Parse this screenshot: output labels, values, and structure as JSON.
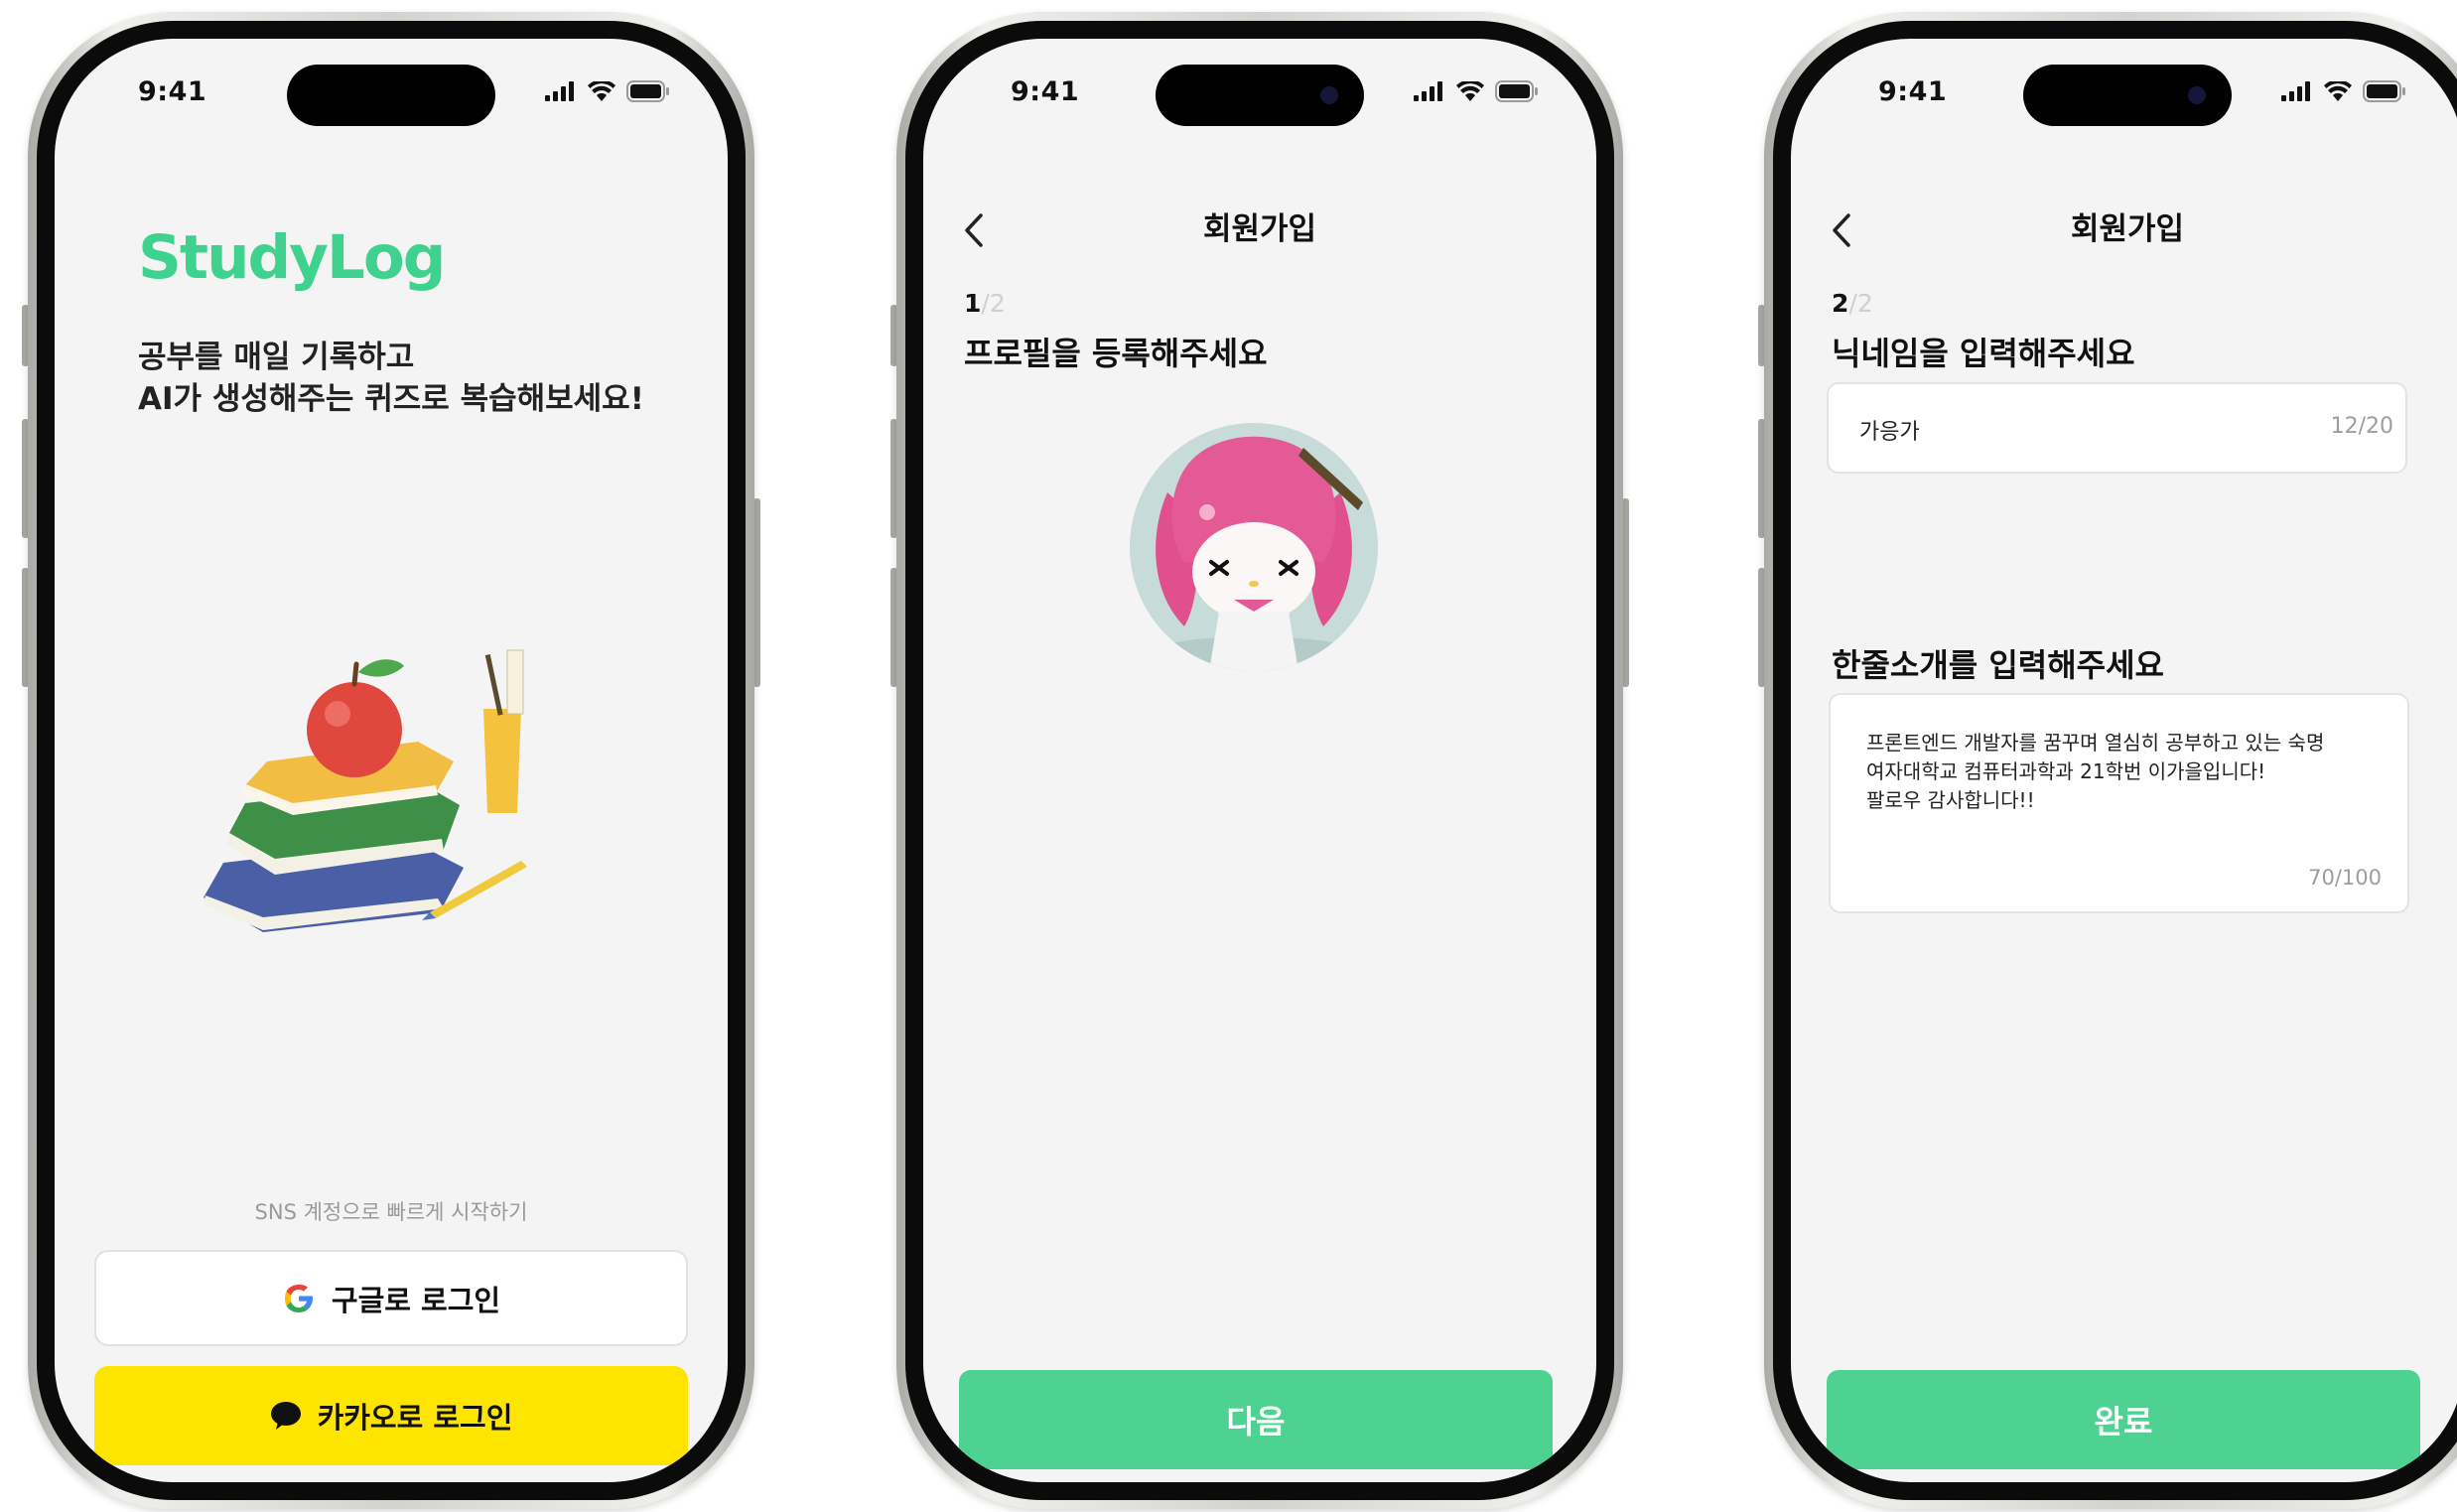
{
  "status_bar": {
    "time": "9:41"
  },
  "login": {
    "brand": "StudyLog",
    "tagline_line1": "공부를 매일 기록하고",
    "tagline_line2": "AI가 생성해주는 퀴즈로 복습해보세요!",
    "sns_hint": "SNS 계정으로 빠르게 시작하기",
    "google_label": "구글로 로그인",
    "kakao_label": "카카오로 로그인"
  },
  "signup_step1": {
    "title": "회원가입",
    "step_current": "1",
    "step_total": "/2",
    "heading": "프로필을 등록해주세요",
    "next_label": "다음"
  },
  "signup_step2": {
    "title": "회원가입",
    "step_current": "2",
    "step_total": "/2",
    "nickname_heading": "닉네임을 입력해주세요",
    "nickname_value": "가응가",
    "nickname_count": "12/20",
    "intro_heading": "한줄소개를 입력해주세요",
    "intro_line1": "프론트엔드 개발자를 꿈꾸며 열심히 공부하고 있는 숙명",
    "intro_line2": "여자대학교 컴퓨터과학과 21학번 이가을입니다!",
    "intro_line3": "팔로우 감사합니다!!",
    "intro_count": "70/100",
    "done_label": "완료"
  },
  "colors": {
    "brand_green": "#3fd28e",
    "button_green": "#4ed292",
    "kakao_yellow": "#fee500",
    "screen_bg": "#f4f4f4"
  },
  "icons": [
    "signal-icon",
    "wifi-icon",
    "battery-icon",
    "back-chevron-icon",
    "google-logo-icon",
    "kakao-speech-bubble-icon"
  ]
}
